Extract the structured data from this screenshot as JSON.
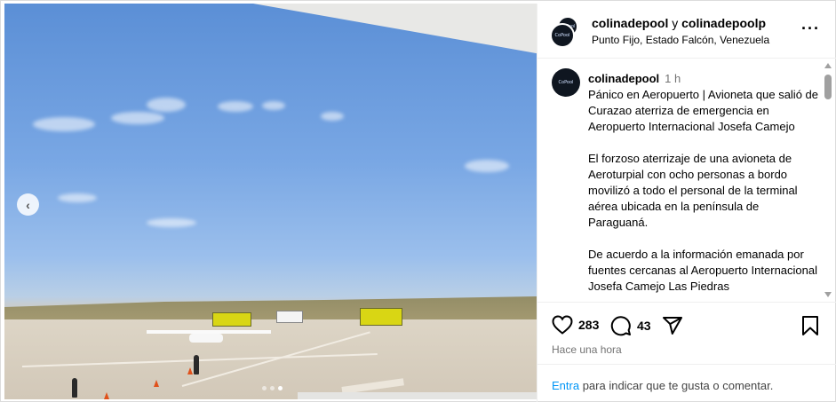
{
  "post": {
    "photo_alt": "",
    "carousel": {
      "count": 3,
      "active_index": 2
    }
  },
  "header": {
    "user1": "colinadepool",
    "joiner": " y ",
    "user2": "colinadepoolp",
    "location": "Punto Fijo, Estado Falcón, Venezuela",
    "avatar_text": "CoPool"
  },
  "caption": {
    "username": "colinadepool",
    "time": "1 h",
    "paragraphs": [
      "Pánico en Aeropuerto | Avioneta que salió de Curazao aterriza de emergencia en Aeropuerto Internacional Josefa Camejo",
      "El forzoso aterrizaje de una avioneta de Aeroturpial con ocho personas a bordo movilizó a todo el personal de la terminal aérea ubicada en la península de Paraguaná.",
      "De acuerdo a la información emanada por fuentes cercanas al Aeropuerto Internacional Josefa Camejo Las Piedras"
    ]
  },
  "actions": {
    "likes": "283",
    "comments": "43",
    "timestamp": "Hace una hora"
  },
  "footer": {
    "link": "Entra",
    "text": " para indicar que te gusta o comentar."
  },
  "colors": {
    "link": "#0095f6",
    "muted": "#737373"
  },
  "icons": [
    "chevron-left-icon",
    "more-icon",
    "heart-icon",
    "comment-icon",
    "share-icon",
    "bookmark-icon"
  ]
}
